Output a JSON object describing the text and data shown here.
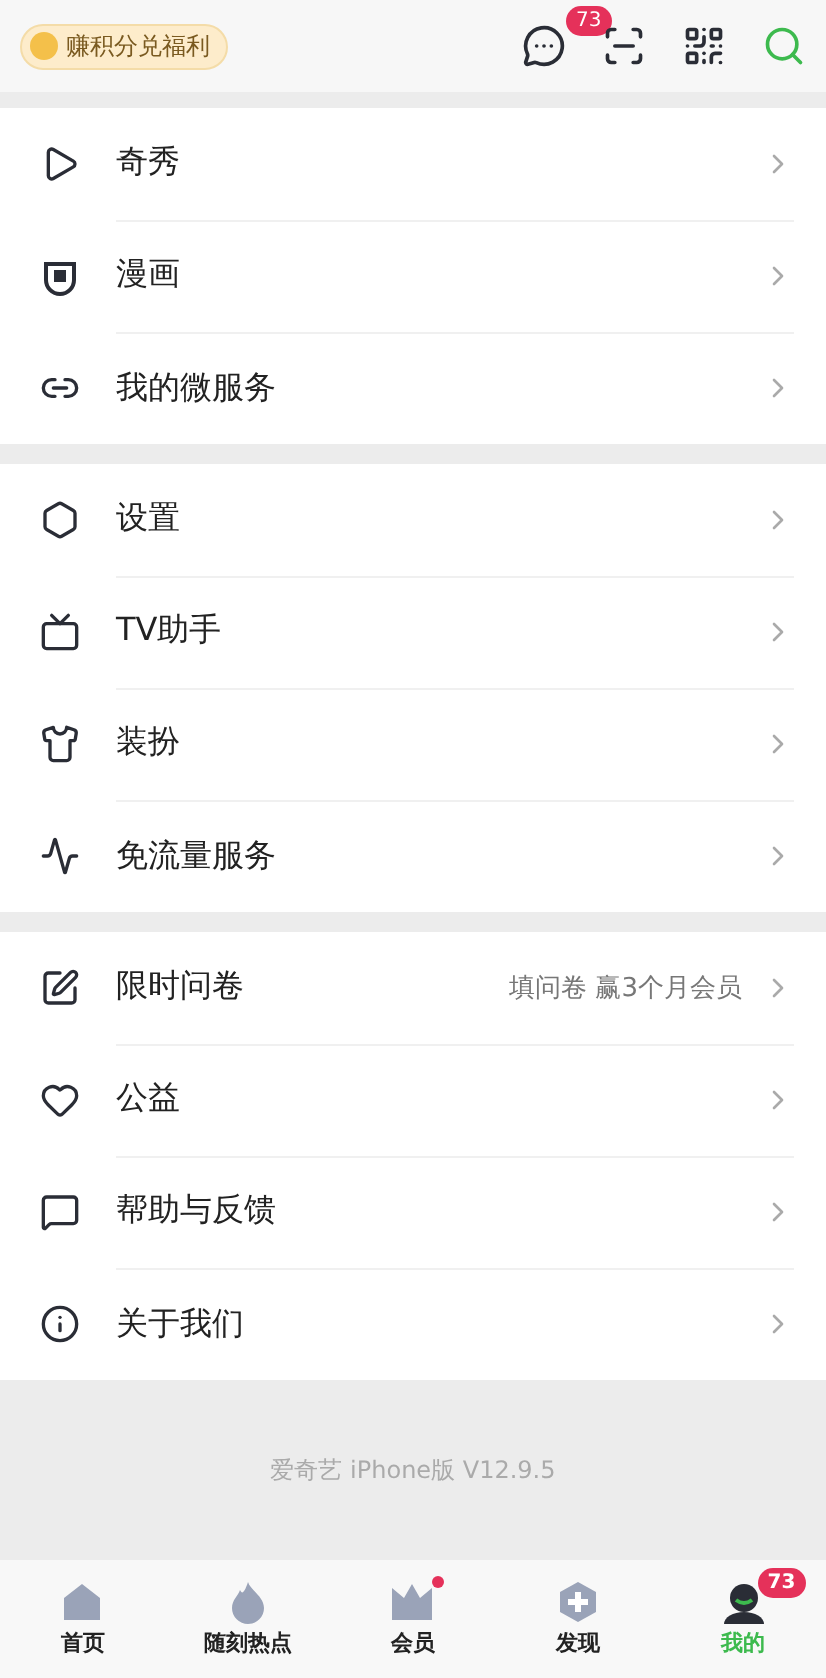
{
  "header": {
    "promo": "赚积分兑福利",
    "message_badge": "73"
  },
  "sections": [
    {
      "items": [
        {
          "label": "奇秀"
        },
        {
          "label": "漫画"
        },
        {
          "label": "我的微服务"
        }
      ]
    },
    {
      "items": [
        {
          "label": "设置"
        },
        {
          "label": "TV助手"
        },
        {
          "label": "装扮"
        },
        {
          "label": "免流量服务"
        }
      ]
    },
    {
      "items": [
        {
          "label": "限时问卷",
          "note": "填问卷 赢3个月会员"
        },
        {
          "label": "公益"
        },
        {
          "label": "帮助与反馈"
        },
        {
          "label": "关于我们"
        }
      ]
    }
  ],
  "version": "爱奇艺 iPhone版 V12.9.5",
  "tabs": [
    {
      "label": "首页",
      "selected": false
    },
    {
      "label": "随刻热点",
      "selected": false
    },
    {
      "label": "会员",
      "selected": false,
      "dot": true
    },
    {
      "label": "发现",
      "selected": false
    },
    {
      "label": "我的",
      "selected": true,
      "badge": "73"
    }
  ]
}
